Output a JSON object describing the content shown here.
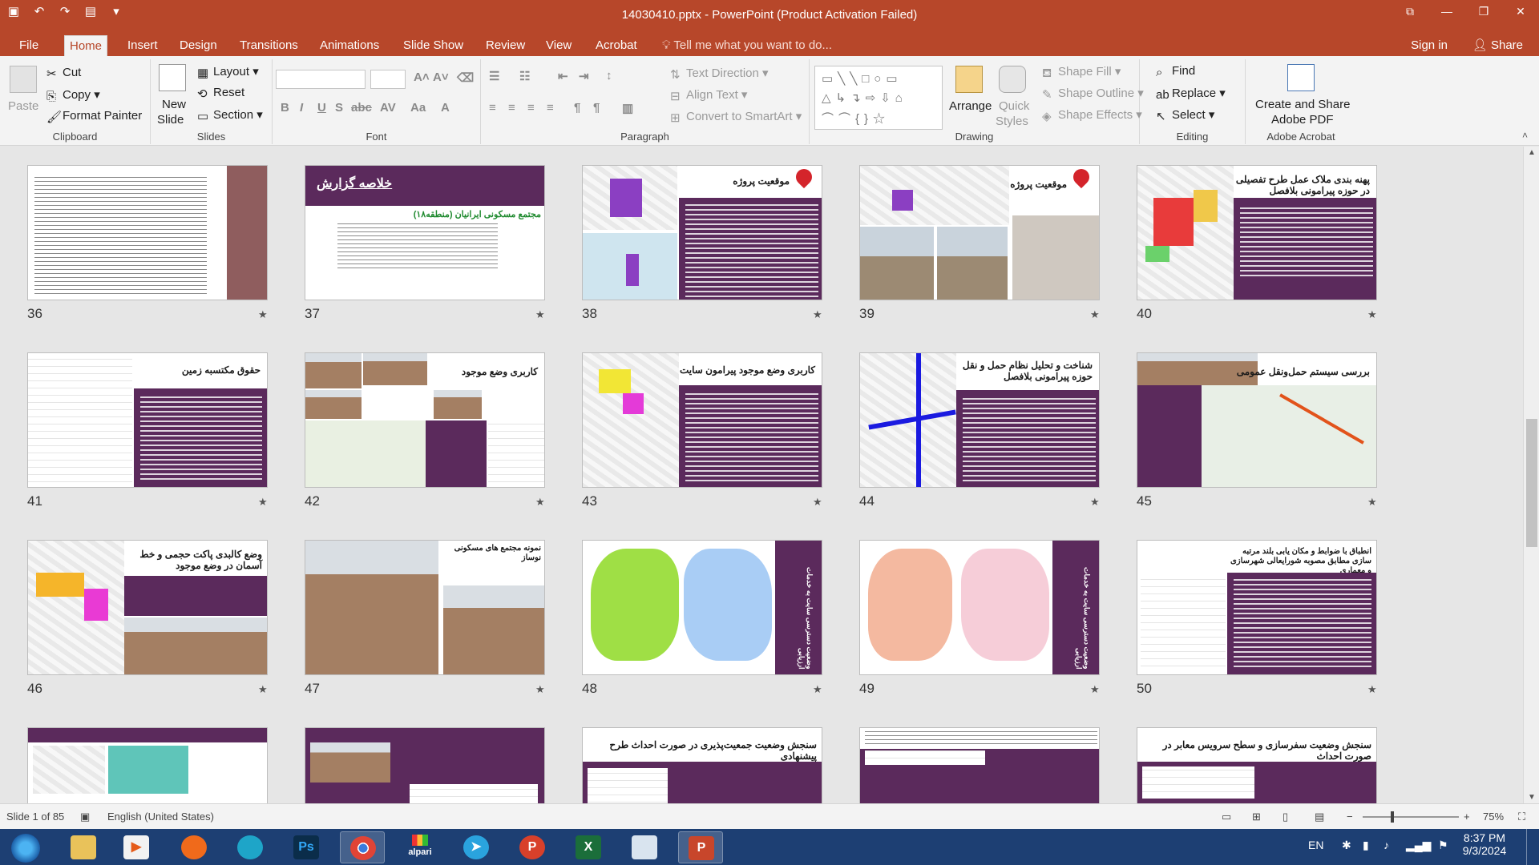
{
  "window": {
    "title": "14030410.pptx - PowerPoint (Product Activation Failed)",
    "controls": [
      "restore-ribbon",
      "minimize",
      "maximize",
      "close"
    ]
  },
  "tabs": {
    "file": "File",
    "home": "Home",
    "insert": "Insert",
    "design": "Design",
    "transitions": "Transitions",
    "animations": "Animations",
    "slideshow": "Slide Show",
    "review": "Review",
    "view": "View",
    "acrobat": "Acrobat",
    "tell_me": "Tell me what you want to do...",
    "sign_in": "Sign in",
    "share": "Share"
  },
  "ribbon": {
    "clipboard": {
      "label": "Clipboard",
      "paste": "Paste",
      "cut": "Cut",
      "copy": "Copy",
      "format_painter": "Format Painter"
    },
    "slides": {
      "label": "Slides",
      "new_slide": "New",
      "new_slide_2": "Slide",
      "layout": "Layout",
      "reset": "Reset",
      "section": "Section"
    },
    "font": {
      "label": "Font"
    },
    "paragraph": {
      "label": "Paragraph",
      "text_direction": "Text Direction",
      "align_text": "Align Text",
      "convert_smartart": "Convert to SmartArt"
    },
    "drawing": {
      "label": "Drawing",
      "arrange": "Arrange",
      "quick_styles": "Quick",
      "quick_styles_2": "Styles",
      "shape_fill": "Shape Fill",
      "shape_outline": "Shape Outline",
      "shape_effects": "Shape Effects"
    },
    "editing": {
      "label": "Editing",
      "find": "Find",
      "replace": "Replace",
      "select": "Select"
    },
    "acrobat": {
      "label": "Adobe Acrobat",
      "create_share": "Create and Share",
      "create_share_2": "Adobe PDF"
    }
  },
  "slides": [
    {
      "num": "36",
      "title": ""
    },
    {
      "num": "37",
      "title": "خلاصه گزارش",
      "subtitle": "مجتمع مسکونی ایرانیان (منطقه۱۸)"
    },
    {
      "num": "38",
      "title": "موقعیت پروژه"
    },
    {
      "num": "39",
      "title": "موقعیت پروژه"
    },
    {
      "num": "40",
      "title": "پهنه بندی ملاک عمل طرح تفصیلی در حوزه پیرامونی بلافصل"
    },
    {
      "num": "41",
      "title": "حقوق مکتسبه زمین"
    },
    {
      "num": "42",
      "title": "کاربری وضع موجود"
    },
    {
      "num": "43",
      "title": "کاربری وضع موجود پیرامون سایت"
    },
    {
      "num": "44",
      "title": "شناخت و تحلیل نظام حمل و نقل حوزه پیرامونی بلافصل"
    },
    {
      "num": "45",
      "title": "بررسی سیستم حمل‌ونقل عمومی"
    },
    {
      "num": "46",
      "title": "وضع کالبدی پاکت حجمی و خط آسمان در وضع موجود"
    },
    {
      "num": "47",
      "title": "نمونه مجتمع های مسکونی نوساز"
    },
    {
      "num": "48",
      "title": "وضعیت دسترسی سایت به خدمات ارزیابی"
    },
    {
      "num": "49",
      "title": "وضعیت دسترسی سایت به خدمات ارزیابی"
    },
    {
      "num": "50",
      "title": "انطباق با ضوابط و مکان یابی بلند مرتبه سازی مطابق مصوبه شورایعالی شهرسازی و معماری"
    },
    {
      "num": "51",
      "title": ""
    },
    {
      "num": "52",
      "title": ""
    },
    {
      "num": "53",
      "title": "سنجش وضعیت جمعیت‌پذیری در صورت احداث طرح پیشنهادی"
    },
    {
      "num": "54",
      "title": ""
    },
    {
      "num": "55",
      "title": "سنجش وضعیت سفرسازی و سطح سرویس معابر در صورت احداث"
    }
  ],
  "status": {
    "slide_info": "Slide 1 of 85",
    "language": "English (United States)",
    "zoom": "75%"
  },
  "taskbar": {
    "items": [
      "start-orb",
      "file-explorer",
      "media-player",
      "firefox",
      "edge",
      "photoshop",
      "chrome",
      "alpari",
      "telegram",
      "p-app",
      "excel-app",
      "paint",
      "powerpoint"
    ],
    "alpari_label": "alpari",
    "lang": "EN",
    "time": "8:37 PM",
    "date": "9/3/2024"
  },
  "colors": {
    "accent": "#b7472a",
    "slide_purple": "#5b2a5c",
    "taskbar": "#1d3f73"
  }
}
